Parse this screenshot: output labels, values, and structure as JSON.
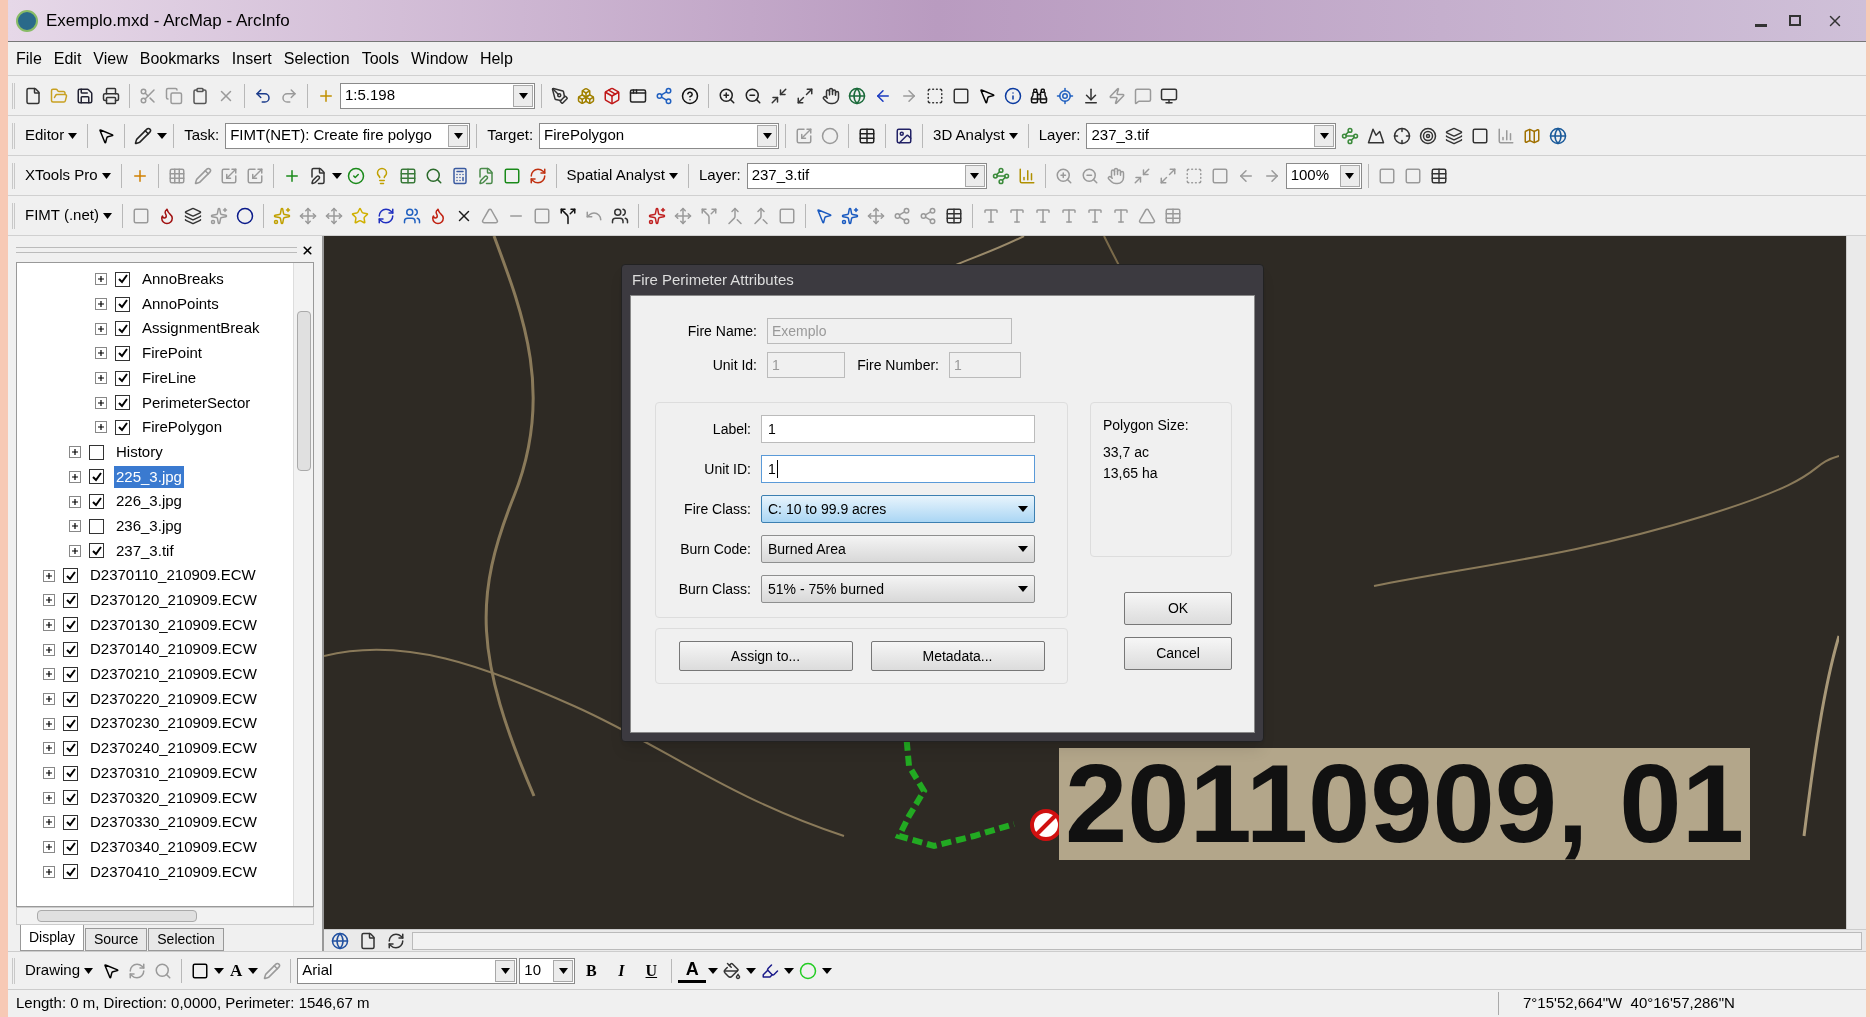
{
  "window": {
    "title": "Exemplo.mxd - ArcMap - ArcInfo"
  },
  "menu": [
    "File",
    "Edit",
    "View",
    "Bookmarks",
    "Insert",
    "Selection",
    "Tools",
    "Window",
    "Help"
  ],
  "standard_toolbar": {
    "scale": "1:5.198"
  },
  "editor_toolbar": {
    "menu": "Editor",
    "task_label": "Task:",
    "task": "FIMT(NET): Create fire polygo",
    "target_label": "Target:",
    "target": "FirePolygon"
  },
  "analyst_3d_toolbar": {
    "menu": "3D Analyst",
    "layer_label": "Layer:",
    "layer": "237_3.tif"
  },
  "xtools_toolbar": {
    "menu": "XTools Pro"
  },
  "spatial_analyst_toolbar": {
    "menu": "Spatial Analyst",
    "layer_label": "Layer:",
    "layer": "237_3.tif",
    "zoom": "100%"
  },
  "fimt_toolbar": {
    "menu": "FIMT (.net)"
  },
  "toc": {
    "layers": [
      {
        "children": [
          {
            "children": [
              {
                "label": "AnnoBreaks",
                "checked": true,
                "selected": false
              },
              {
                "label": "AnnoPoints",
                "checked": true,
                "selected": false
              },
              {
                "label": "AssignmentBreak",
                "checked": true,
                "selected": false
              },
              {
                "label": "FirePoint",
                "checked": true,
                "selected": false
              },
              {
                "label": "FireLine",
                "checked": true,
                "selected": false
              },
              {
                "label": "PerimeterSector",
                "checked": true,
                "selected": false
              },
              {
                "label": "FirePolygon",
                "checked": true,
                "selected": false
              }
            ]
          },
          {
            "label": "History",
            "checked": false,
            "selected": false
          },
          {
            "label": "225_3.jpg",
            "checked": true,
            "selected": true
          },
          {
            "label": "226_3.jpg",
            "checked": true,
            "selected": false
          },
          {
            "label": "236_3.jpg",
            "checked": false,
            "selected": false
          },
          {
            "label": "237_3.tif",
            "checked": true,
            "selected": false
          }
        ]
      },
      {
        "label": "D2370110_210909.ECW",
        "checked": true,
        "selected": false
      },
      {
        "label": "D2370120_210909.ECW",
        "checked": true,
        "selected": false
      },
      {
        "label": "D2370130_210909.ECW",
        "checked": true,
        "selected": false
      },
      {
        "label": "D2370140_210909.ECW",
        "checked": true,
        "selected": false
      },
      {
        "label": "D2370210_210909.ECW",
        "checked": true,
        "selected": false
      },
      {
        "label": "D2370220_210909.ECW",
        "checked": true,
        "selected": false
      },
      {
        "label": "D2370230_210909.ECW",
        "checked": true,
        "selected": false
      },
      {
        "label": "D2370240_210909.ECW",
        "checked": true,
        "selected": false
      },
      {
        "label": "D2370310_210909.ECW",
        "checked": true,
        "selected": false
      },
      {
        "label": "D2370320_210909.ECW",
        "checked": true,
        "selected": false
      },
      {
        "label": "D2370330_210909.ECW",
        "checked": true,
        "selected": false
      },
      {
        "label": "D2370340_210909.ECW",
        "checked": true,
        "selected": false
      },
      {
        "label": "D2370410_210909.ECW",
        "checked": true,
        "selected": false
      }
    ],
    "tabs": [
      {
        "label": "Display",
        "selected": true
      },
      {
        "label": "Source",
        "selected": false
      },
      {
        "label": "Selection",
        "selected": false
      }
    ]
  },
  "map": {
    "label": "20110909, 01"
  },
  "dialog": {
    "title": "Fire Perimeter Attributes",
    "header_fields": [
      {
        "label": "Fire Name:",
        "value": "Exemplo",
        "disabled": true
      }
    ],
    "id_fields": [
      {
        "label": "Unit Id:",
        "value": "1",
        "disabled": true
      },
      {
        "label": "Fire Number:",
        "value": "1",
        "disabled": true
      }
    ],
    "fields": [
      {
        "kind": "text",
        "label": "Label:",
        "value": "1",
        "focused": false
      },
      {
        "kind": "text",
        "label": "Unit ID:",
        "value": "1",
        "focused": true
      },
      {
        "kind": "select",
        "label": "Fire Class:",
        "value": "C: 10 to 99.9 acres",
        "focused": true
      },
      {
        "kind": "select",
        "label": "Burn Code:",
        "value": "Burned Area",
        "focused": false
      },
      {
        "kind": "select",
        "label": "Burn Class:",
        "value": "51% - 75% burned",
        "focused": false
      }
    ],
    "polygon_size": {
      "label": "Polygon Size:",
      "values": [
        "33,7 ac",
        "13,65 ha"
      ]
    },
    "action_buttons": [
      "Assign to...",
      "Metadata..."
    ],
    "buttons": [
      "OK",
      "Cancel"
    ]
  },
  "drawing_toolbar": {
    "menu": "Drawing",
    "text_tool": "A",
    "font": "Arial",
    "size": "10",
    "bold": "B",
    "italic": "I",
    "underline": "U",
    "font_color": "A"
  },
  "status_bar": {
    "measure": "Length: 0 m, Direction: 0,0000, Perimeter: 1546,67 m",
    "coordinates": "7°15'52,664\"W  40°16'57,286\"N"
  }
}
